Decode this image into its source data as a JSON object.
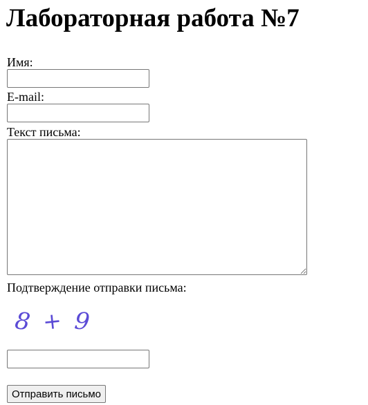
{
  "page": {
    "title": "Лабораторная работа №7"
  },
  "form": {
    "name_label": "Имя:",
    "name_value": "",
    "email_label": "E-mail:",
    "email_value": "",
    "message_label": "Текст письма:",
    "message_value": "",
    "confirm_label": "Подтверждение отправки письма:",
    "captcha": {
      "first": "8",
      "operator": "+",
      "second": "9",
      "color": "#5b4bd6"
    },
    "captcha_answer_value": "",
    "submit_label": "Отправить письмо"
  }
}
